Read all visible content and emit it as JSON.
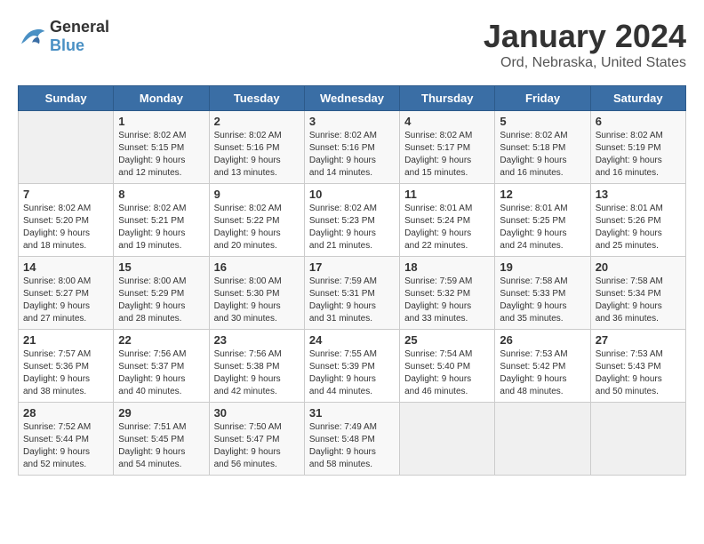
{
  "header": {
    "logo": {
      "general": "General",
      "blue": "Blue"
    },
    "title": "January 2024",
    "subtitle": "Ord, Nebraska, United States"
  },
  "calendar": {
    "days_of_week": [
      "Sunday",
      "Monday",
      "Tuesday",
      "Wednesday",
      "Thursday",
      "Friday",
      "Saturday"
    ],
    "weeks": [
      [
        {
          "day": "",
          "info": ""
        },
        {
          "day": "1",
          "info": "Sunrise: 8:02 AM\nSunset: 5:15 PM\nDaylight: 9 hours\nand 12 minutes."
        },
        {
          "day": "2",
          "info": "Sunrise: 8:02 AM\nSunset: 5:16 PM\nDaylight: 9 hours\nand 13 minutes."
        },
        {
          "day": "3",
          "info": "Sunrise: 8:02 AM\nSunset: 5:16 PM\nDaylight: 9 hours\nand 14 minutes."
        },
        {
          "day": "4",
          "info": "Sunrise: 8:02 AM\nSunset: 5:17 PM\nDaylight: 9 hours\nand 15 minutes."
        },
        {
          "day": "5",
          "info": "Sunrise: 8:02 AM\nSunset: 5:18 PM\nDaylight: 9 hours\nand 16 minutes."
        },
        {
          "day": "6",
          "info": "Sunrise: 8:02 AM\nSunset: 5:19 PM\nDaylight: 9 hours\nand 16 minutes."
        }
      ],
      [
        {
          "day": "7",
          "info": "Sunrise: 8:02 AM\nSunset: 5:20 PM\nDaylight: 9 hours\nand 18 minutes."
        },
        {
          "day": "8",
          "info": "Sunrise: 8:02 AM\nSunset: 5:21 PM\nDaylight: 9 hours\nand 19 minutes."
        },
        {
          "day": "9",
          "info": "Sunrise: 8:02 AM\nSunset: 5:22 PM\nDaylight: 9 hours\nand 20 minutes."
        },
        {
          "day": "10",
          "info": "Sunrise: 8:02 AM\nSunset: 5:23 PM\nDaylight: 9 hours\nand 21 minutes."
        },
        {
          "day": "11",
          "info": "Sunrise: 8:01 AM\nSunset: 5:24 PM\nDaylight: 9 hours\nand 22 minutes."
        },
        {
          "day": "12",
          "info": "Sunrise: 8:01 AM\nSunset: 5:25 PM\nDaylight: 9 hours\nand 24 minutes."
        },
        {
          "day": "13",
          "info": "Sunrise: 8:01 AM\nSunset: 5:26 PM\nDaylight: 9 hours\nand 25 minutes."
        }
      ],
      [
        {
          "day": "14",
          "info": "Sunrise: 8:00 AM\nSunset: 5:27 PM\nDaylight: 9 hours\nand 27 minutes."
        },
        {
          "day": "15",
          "info": "Sunrise: 8:00 AM\nSunset: 5:29 PM\nDaylight: 9 hours\nand 28 minutes."
        },
        {
          "day": "16",
          "info": "Sunrise: 8:00 AM\nSunset: 5:30 PM\nDaylight: 9 hours\nand 30 minutes."
        },
        {
          "day": "17",
          "info": "Sunrise: 7:59 AM\nSunset: 5:31 PM\nDaylight: 9 hours\nand 31 minutes."
        },
        {
          "day": "18",
          "info": "Sunrise: 7:59 AM\nSunset: 5:32 PM\nDaylight: 9 hours\nand 33 minutes."
        },
        {
          "day": "19",
          "info": "Sunrise: 7:58 AM\nSunset: 5:33 PM\nDaylight: 9 hours\nand 35 minutes."
        },
        {
          "day": "20",
          "info": "Sunrise: 7:58 AM\nSunset: 5:34 PM\nDaylight: 9 hours\nand 36 minutes."
        }
      ],
      [
        {
          "day": "21",
          "info": "Sunrise: 7:57 AM\nSunset: 5:36 PM\nDaylight: 9 hours\nand 38 minutes."
        },
        {
          "day": "22",
          "info": "Sunrise: 7:56 AM\nSunset: 5:37 PM\nDaylight: 9 hours\nand 40 minutes."
        },
        {
          "day": "23",
          "info": "Sunrise: 7:56 AM\nSunset: 5:38 PM\nDaylight: 9 hours\nand 42 minutes."
        },
        {
          "day": "24",
          "info": "Sunrise: 7:55 AM\nSunset: 5:39 PM\nDaylight: 9 hours\nand 44 minutes."
        },
        {
          "day": "25",
          "info": "Sunrise: 7:54 AM\nSunset: 5:40 PM\nDaylight: 9 hours\nand 46 minutes."
        },
        {
          "day": "26",
          "info": "Sunrise: 7:53 AM\nSunset: 5:42 PM\nDaylight: 9 hours\nand 48 minutes."
        },
        {
          "day": "27",
          "info": "Sunrise: 7:53 AM\nSunset: 5:43 PM\nDaylight: 9 hours\nand 50 minutes."
        }
      ],
      [
        {
          "day": "28",
          "info": "Sunrise: 7:52 AM\nSunset: 5:44 PM\nDaylight: 9 hours\nand 52 minutes."
        },
        {
          "day": "29",
          "info": "Sunrise: 7:51 AM\nSunset: 5:45 PM\nDaylight: 9 hours\nand 54 minutes."
        },
        {
          "day": "30",
          "info": "Sunrise: 7:50 AM\nSunset: 5:47 PM\nDaylight: 9 hours\nand 56 minutes."
        },
        {
          "day": "31",
          "info": "Sunrise: 7:49 AM\nSunset: 5:48 PM\nDaylight: 9 hours\nand 58 minutes."
        },
        {
          "day": "",
          "info": ""
        },
        {
          "day": "",
          "info": ""
        },
        {
          "day": "",
          "info": ""
        }
      ]
    ]
  }
}
